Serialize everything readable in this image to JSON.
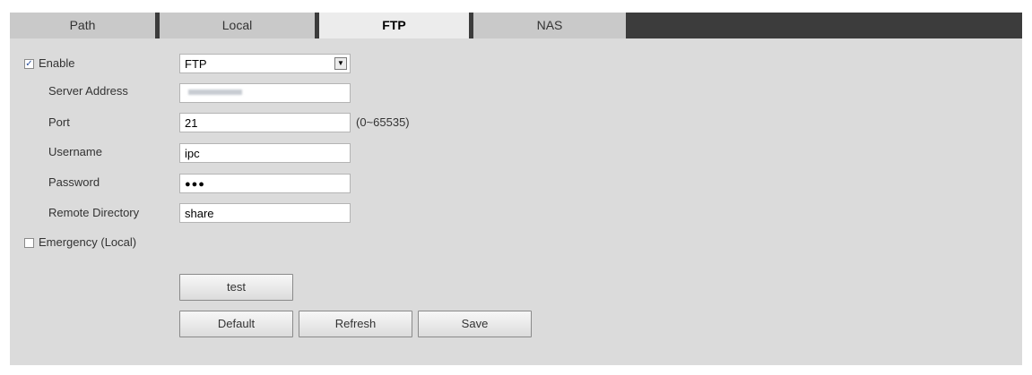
{
  "tabs": [
    {
      "label": "Path"
    },
    {
      "label": "Local"
    },
    {
      "label": "FTP"
    },
    {
      "label": "NAS"
    }
  ],
  "active_tab": "FTP",
  "form": {
    "enable": {
      "label": "Enable",
      "checked": true,
      "check_glyph": "✓"
    },
    "protocol": {
      "value": "FTP",
      "arrow_glyph": "▼"
    },
    "server_address": {
      "label": "Server Address",
      "value": ""
    },
    "port": {
      "label": "Port",
      "value": "21",
      "hint": "(0~65535)"
    },
    "username": {
      "label": "Username",
      "value": "ipc"
    },
    "password": {
      "label": "Password",
      "value": "●●●"
    },
    "remote_directory": {
      "label": "Remote Directory",
      "value": "share"
    },
    "emergency": {
      "label": "Emergency (Local)",
      "checked": false
    }
  },
  "buttons": {
    "test": "test",
    "default": "Default",
    "refresh": "Refresh",
    "save": "Save"
  },
  "colors": {
    "panel_bg": "#dbdbdb",
    "tab_bar": "#3c3c3c",
    "tab_inactive": "#c9c9c9",
    "tab_active": "#ececec",
    "check_mark": "#2a4f9c"
  }
}
